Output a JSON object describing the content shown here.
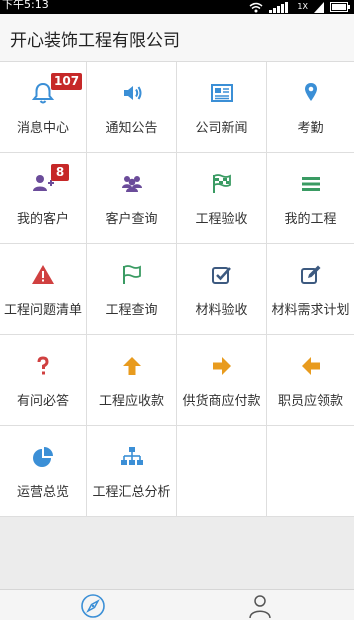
{
  "status_bar": {
    "time": "下午5:13",
    "signal_label": "1X"
  },
  "header": {
    "title": "开心装饰工程有限公司"
  },
  "colors": {
    "blue": "#3b8fd6",
    "purple": "#6b4c9a",
    "green": "#3a9b63",
    "steel": "#3d5a80",
    "red": "#d04040",
    "orange": "#e89b1e",
    "badge": "#c62828"
  },
  "grid": [
    {
      "label": "消息中心",
      "icon": "bell-icon",
      "badge": "107"
    },
    {
      "label": "通知公告",
      "icon": "speaker-icon"
    },
    {
      "label": "公司新闻",
      "icon": "newspaper-icon"
    },
    {
      "label": "考勤",
      "icon": "location-pin-icon"
    },
    {
      "label": "我的客户",
      "icon": "add-user-icon",
      "badge": "8"
    },
    {
      "label": "客户查询",
      "icon": "users-group-icon"
    },
    {
      "label": "工程验收",
      "icon": "checkered-flag-icon"
    },
    {
      "label": "我的工程",
      "icon": "list-icon"
    },
    {
      "label": "工程问题清单",
      "icon": "warning-icon"
    },
    {
      "label": "工程查询",
      "icon": "flag-icon"
    },
    {
      "label": "材料验收",
      "icon": "checkbox-icon"
    },
    {
      "label": "材料需求计划",
      "icon": "edit-icon"
    },
    {
      "label": "有问必答",
      "icon": "question-icon"
    },
    {
      "label": "工程应收款",
      "icon": "arrow-up-icon"
    },
    {
      "label": "供货商应付款",
      "icon": "arrow-right-icon"
    },
    {
      "label": "职员应领款",
      "icon": "arrow-left-icon"
    },
    {
      "label": "运营总览",
      "icon": "pie-chart-icon"
    },
    {
      "label": "工程汇总分析",
      "icon": "org-chart-icon"
    }
  ],
  "tabs": [
    {
      "icon": "compass-icon",
      "active": true
    },
    {
      "icon": "user-icon",
      "active": false
    }
  ]
}
